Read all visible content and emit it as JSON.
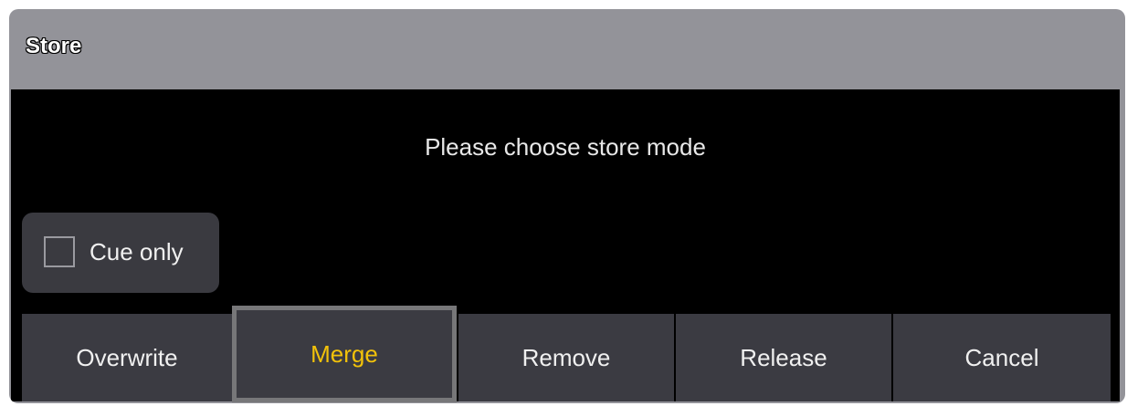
{
  "dialog": {
    "title": "Store",
    "message": "Please choose store mode",
    "cue_only": {
      "label": "Cue only",
      "checked": false
    },
    "buttons": [
      {
        "label": "Overwrite",
        "selected": false
      },
      {
        "label": "Merge",
        "selected": true
      },
      {
        "label": "Remove",
        "selected": false
      },
      {
        "label": "Release",
        "selected": false
      },
      {
        "label": "Cancel",
        "selected": false
      }
    ]
  },
  "colors": {
    "title_bar": "#939399",
    "content_bg": "#000000",
    "button_bg": "#3b3b42",
    "selected_text": "#f2c20a",
    "selected_border": "#777779"
  }
}
